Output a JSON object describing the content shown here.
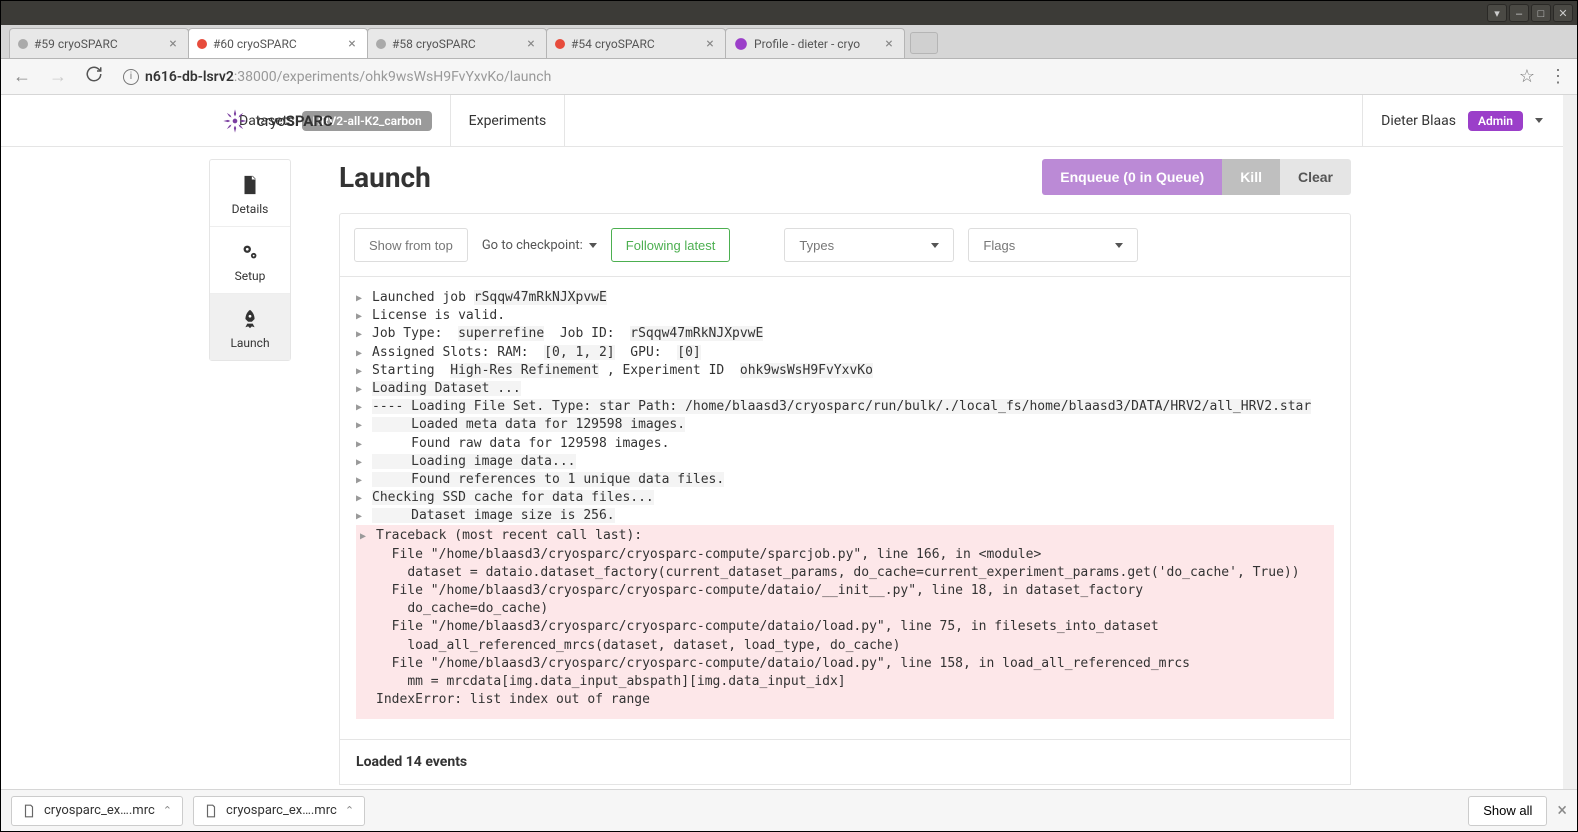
{
  "window": {
    "tabs": [
      {
        "title": "#59 cryoSPARC",
        "status": "gray"
      },
      {
        "title": "#60 cryoSPARC",
        "status": "red",
        "active": true
      },
      {
        "title": "#58 cryoSPARC",
        "status": "gray"
      },
      {
        "title": "#54 cryoSPARC",
        "status": "red"
      },
      {
        "title": "Profile - dieter - cryo",
        "status": "favicon"
      }
    ],
    "url_host": "n616-db-lsrv2",
    "url_rest": ":38000/experiments/ohk9wsWsH9FvYxvKo/launch"
  },
  "nav": {
    "brand": "cryoSPARC",
    "datasets": "Datasets",
    "dataset_badge": "HRV2-all-K2_carbon",
    "experiments": "Experiments",
    "user": "Dieter Blaas",
    "admin": "Admin"
  },
  "sidebar": {
    "details": "Details",
    "setup": "Setup",
    "launch": "Launch"
  },
  "page": {
    "title": "Launch",
    "enqueue": "Enqueue (0 in Queue)",
    "kill": "Kill",
    "clear": "Clear"
  },
  "filters": {
    "show_from_top": "Show from top",
    "goto_checkpoint": "Go to checkpoint:",
    "following": "Following latest",
    "types": "Types",
    "flags": "Flags"
  },
  "log": [
    {
      "t": "Launched job ",
      "hl": "rSqqw47mRkNJXpvwE"
    },
    {
      "t": "License is valid."
    },
    {
      "t": "Job Type:  ",
      "hl": "superrefine",
      "t2": "  Job ID:  ",
      "hl2": "rSqqw47mRkNJXpvwE"
    },
    {
      "t": "Assigned Slots: RAM:  ",
      "hl": "[0, 1, 2]",
      "t2": "  GPU:  ",
      "hl2": "[0]"
    },
    {
      "t": "Starting  ",
      "hl": "High-Res Refinement",
      "t2": " , Experiment ID  ",
      "hl2": "ohk9wsWsH9FvYxvKo"
    },
    {
      "t": "Loading Dataset ...",
      "hlself": true
    },
    {
      "t": "---- Loading File Set. Type: star Path: /home/blaasd3/cryosparc/run/bulk/./local_fs/home/blaasd3/DATA/HRV2/all_HRV2.star",
      "hlself": true
    },
    {
      "t": "     Loaded meta data for 129598 images.",
      "hlself": true
    },
    {
      "t": "     Found raw data for 129598 images."
    },
    {
      "t": "     Loading image data...",
      "hlself": true
    },
    {
      "t": "     Found references to 1 unique data files.",
      "hlself": true
    },
    {
      "t": "Checking SSD cache for data files...",
      "hlself": true
    },
    {
      "t": "     Dataset image size is 256.",
      "hlself": true
    }
  ],
  "traceback": "Traceback (most recent call last):\n  File \"/home/blaasd3/cryosparc/cryosparc-compute/sparcjob.py\", line 166, in <module>\n    dataset = dataio.dataset_factory(current_dataset_params, do_cache=current_experiment_params.get('do_cache', True))\n  File \"/home/blaasd3/cryosparc/cryosparc-compute/dataio/__init__.py\", line 18, in dataset_factory\n    do_cache=do_cache)\n  File \"/home/blaasd3/cryosparc/cryosparc-compute/dataio/load.py\", line 75, in filesets_into_dataset\n    load_all_referenced_mrcs(dataset, dataset, load_type, do_cache)\n  File \"/home/blaasd3/cryosparc/cryosparc-compute/dataio/load.py\", line 158, in load_all_referenced_mrcs\n    mm = mrcdata[img.data_input_abspath][img.data_input_idx]\nIndexError: list index out of range",
  "footer": "Loaded 14 events",
  "downloads": {
    "file1": "cryosparc_ex….mrc",
    "file2": "cryosparc_ex….mrc",
    "showall": "Show all"
  }
}
